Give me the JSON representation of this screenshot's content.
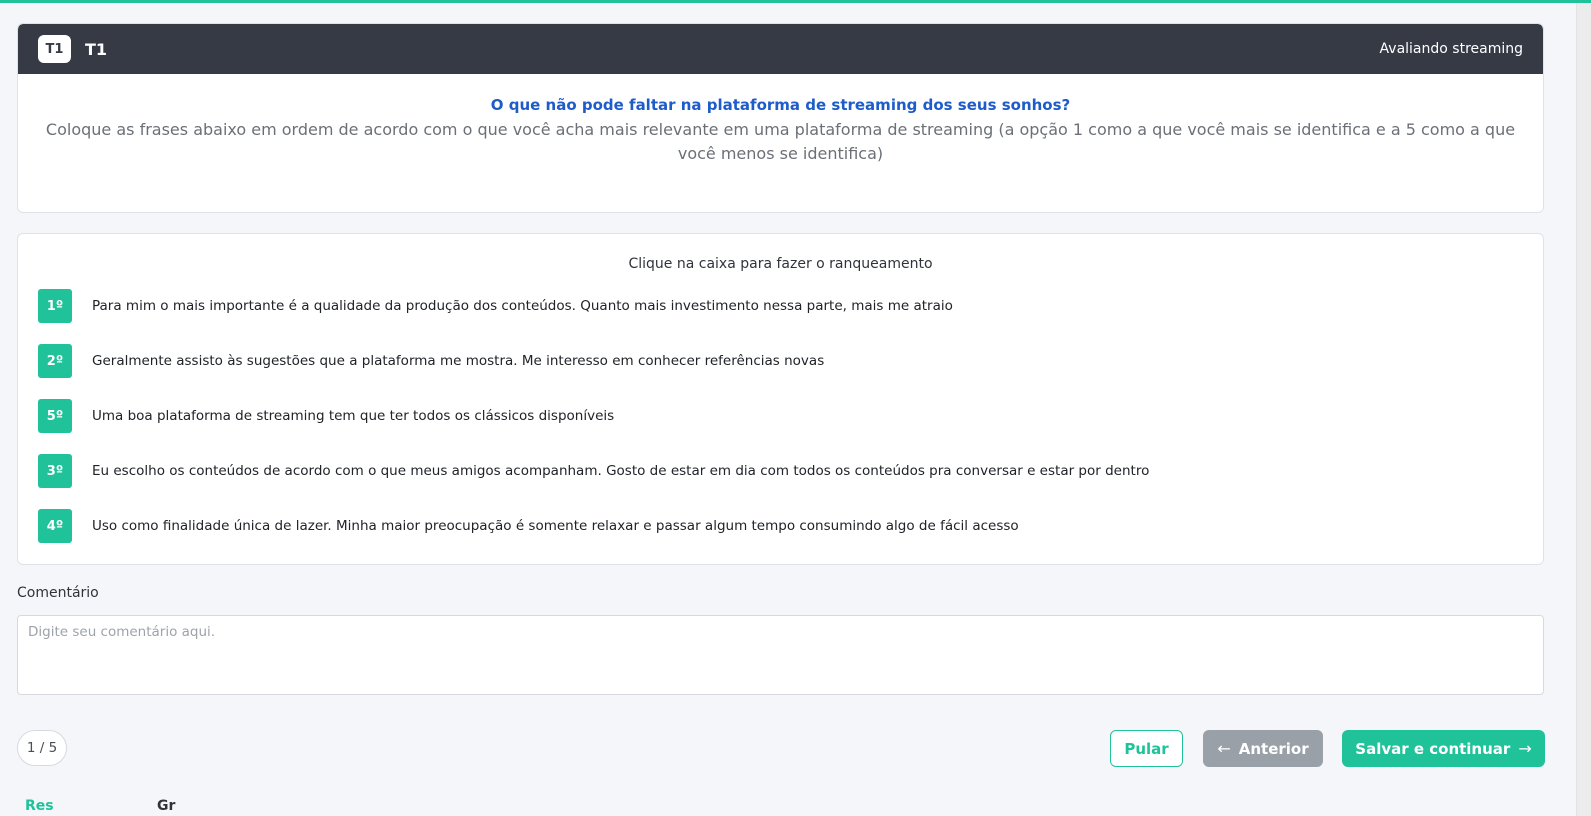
{
  "header": {
    "badge": "T1",
    "title": "T1",
    "right_text": "Avaliando streaming"
  },
  "question": {
    "title": "O que não pode faltar na plataforma de streaming dos seus sonhos?",
    "text": "Coloque as frases abaixo em ordem de acordo com o que você acha mais relevante em uma plataforma de streaming (a opção 1 como a que você mais se identifica e a 5 como a que você menos se identifica)"
  },
  "ranking": {
    "hint": "Clique na caixa para fazer o ranqueamento",
    "items": [
      {
        "rank": "1º",
        "text": "Para mim o mais importante é a qualidade da produção dos conteúdos. Quanto mais investimento nessa parte, mais me atraio"
      },
      {
        "rank": "2º",
        "text": "Geralmente assisto às sugestões que a plataforma me mostra. Me interesso em conhecer referências novas"
      },
      {
        "rank": "5º",
        "text": "Uma boa plataforma de streaming tem que ter todos os clássicos disponíveis"
      },
      {
        "rank": "3º",
        "text": "Eu escolho os conteúdos de acordo com o que meus amigos acompanham. Gosto de estar em dia com todos os conteúdos pra conversar e estar por dentro"
      },
      {
        "rank": "4º",
        "text": "Uso como finalidade única de lazer. Minha maior preocupação é somente relaxar e passar algum tempo consumindo algo de fácil acesso"
      }
    ]
  },
  "comment": {
    "label": "Comentário",
    "placeholder": "Digite seu comentário aqui.",
    "value": ""
  },
  "pager": {
    "text": "1 / 5"
  },
  "buttons": {
    "skip": "Pular",
    "previous": "Anterior",
    "save_continue": "Salvar e continuar"
  },
  "bottom_tabs": {
    "a": "Res",
    "b": "Gr"
  },
  "colors": {
    "accent": "#20c29a",
    "header_bg": "#363a45",
    "question_title": "#1d5cc9",
    "secondary_button": "#9aa0a8"
  },
  "icons": {
    "previous": "arrow-left-icon",
    "next": "arrow-right-icon"
  }
}
